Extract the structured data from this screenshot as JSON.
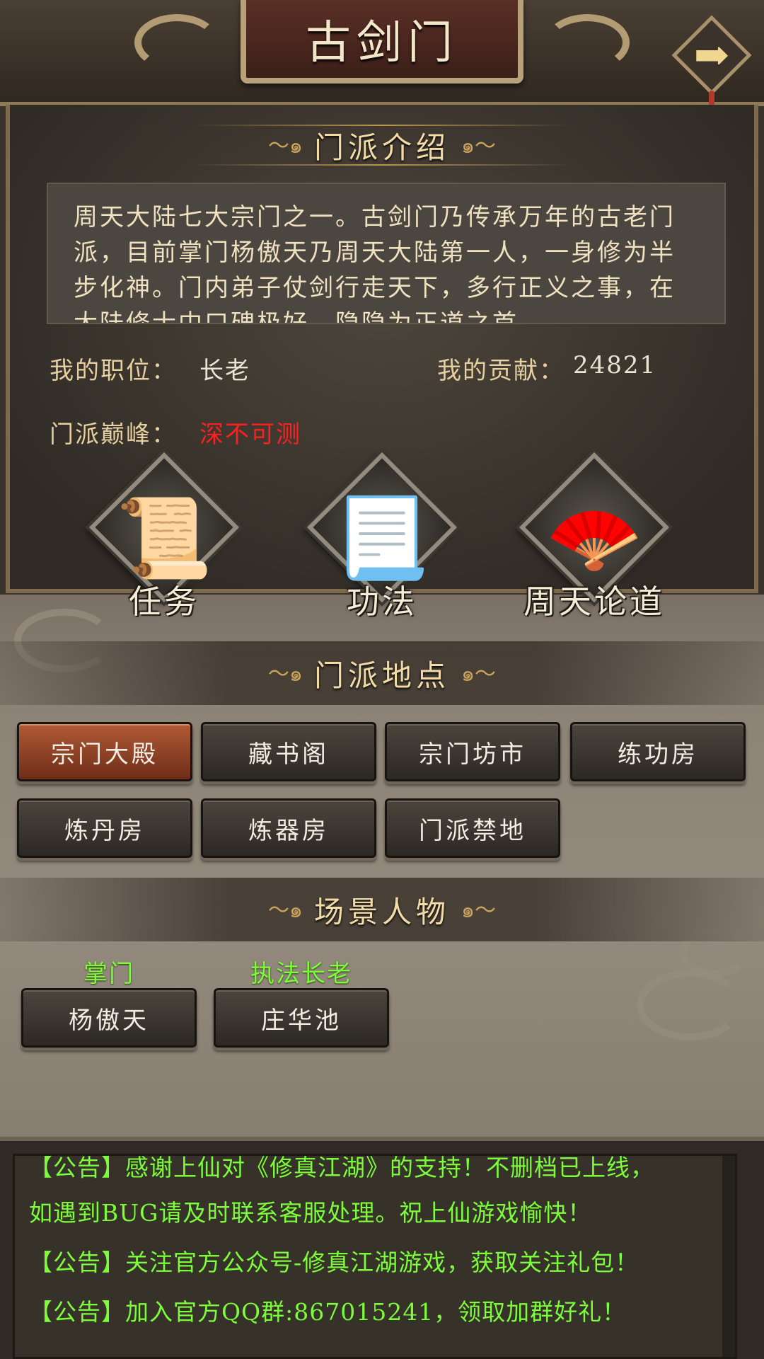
{
  "header": {
    "title": "古剑门",
    "back_icon": "arrow-right-icon"
  },
  "intro": {
    "section_title": "门派介绍",
    "lines": [
      "周天大陆七大宗门之一。古剑门乃传承万年的古老门",
      "派，目前掌门杨傲天乃周天大陆第一人，一身修为半",
      "步化神。门内弟子仗剑行走天下，多行正义之事，在",
      "大陆修士中口碑极好，隐隐为正道之首。"
    ]
  },
  "stats": {
    "position_label": "我的职位：",
    "position_value": "长老",
    "contribution_label": "我的贡献：",
    "contribution_value": "24821",
    "peak_label": "门派巅峰：",
    "peak_value": "深不可测"
  },
  "actions": [
    {
      "label": "任务",
      "icon": "scroll-icon"
    },
    {
      "label": "功法",
      "icon": "open-scroll-icon"
    },
    {
      "label": "周天论道",
      "icon": "fan-icon"
    }
  ],
  "locations": {
    "section_title": "门派地点",
    "items": [
      "宗门大殿",
      "藏书阁",
      "宗门坊市",
      "练功房",
      "炼丹房",
      "炼器房",
      "门派禁地"
    ],
    "active_index": 0
  },
  "characters": {
    "section_title": "场景人物",
    "items": [
      {
        "role": "掌门",
        "name": "杨傲天"
      },
      {
        "role": "执法长老",
        "name": "庄华池"
      }
    ]
  },
  "notices": [
    "【公告】感谢上仙对《修真江湖》的支持！不删档已上线，",
    "如遇到BUG请及时联系客服处理。祝上仙游戏愉快！",
    "【公告】关注官方公众号-修真江湖游戏，获取关注礼包！",
    "【公告】加入官方QQ群:867015241，领取加群好礼！"
  ],
  "colors": {
    "active_button": "#b15a35",
    "notice_text": "#7cfc3a",
    "peak_text": "#ff1f1f",
    "role_text": "#7cfc3a"
  }
}
